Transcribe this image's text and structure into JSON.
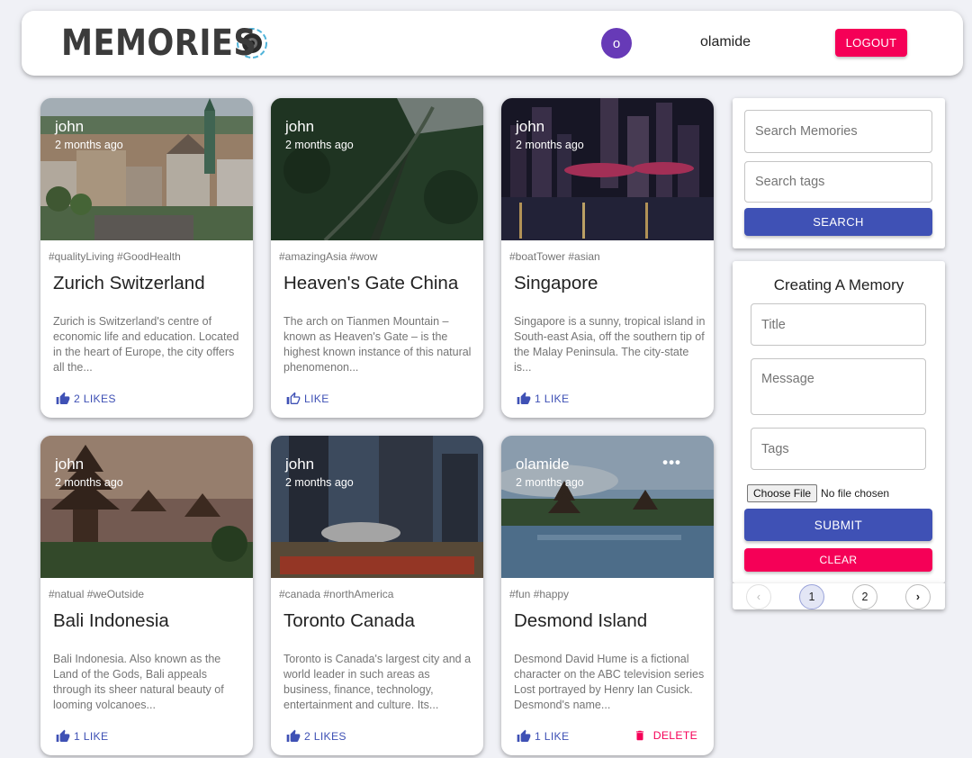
{
  "header": {
    "brand": "Memories",
    "avatar_initial": "o",
    "username": "olamide",
    "logout_label": "LOGOUT"
  },
  "posts": [
    {
      "author": "john",
      "time": "2 months ago",
      "tags": "#qualityLiving #GoodHealth",
      "title": "Zurich Switzerland",
      "message": "Zurich is Switzerland's centre of economic life and education. Located in the heart of Europe, the city offers all the...",
      "likes": "2 LIKES"
    },
    {
      "author": "john",
      "time": "2 months ago",
      "tags": "#amazingAsia #wow",
      "title": "Heaven's Gate China",
      "message": "The arch on Tianmen Mountain – known as Heaven's Gate – is the highest known instance of this natural phenomenon...",
      "likes": "LIKE"
    },
    {
      "author": "john",
      "time": "2 months ago",
      "tags": "#boatTower #asian",
      "title": "Singapore",
      "message": "Singapore is a sunny, tropical island in South-east Asia, off the southern tip of the Malay Peninsula. The city-state is...",
      "likes": "1 LIKE"
    },
    {
      "author": "john",
      "time": "2 months ago",
      "tags": "#natual #weOutside",
      "title": "Bali Indonesia",
      "message": "Bali Indonesia. Also known as the Land of the Gods, Bali appeals through its sheer natural beauty of looming volcanoes...",
      "likes": "1 LIKE"
    },
    {
      "author": "john",
      "time": "2 months ago",
      "tags": "#canada #northAmerica",
      "title": "Toronto Canada",
      "message": "Toronto is Canada's largest city and a world leader in such areas as business, finance, technology, entertainment and culture. Its...",
      "likes": "2 LIKES"
    },
    {
      "author": "olamide",
      "time": "2 months ago",
      "tags": "#fun #happy",
      "title": "Desmond Island",
      "message": "Desmond David Hume is a fictional character on the ABC television series Lost portrayed by Henry Ian Cusick. Desmond's name...",
      "likes": "1 LIKE",
      "more_glyph": "•••",
      "delete_label": "DELETE"
    }
  ],
  "search": {
    "memories_placeholder": "Search Memories",
    "tags_placeholder": "Search tags",
    "button_label": "SEARCH"
  },
  "form": {
    "title": "Creating A Memory",
    "title_placeholder": "Title",
    "message_placeholder": "Message",
    "tags_placeholder": "Tags",
    "file_button": "Choose File",
    "file_status": "No file chosen",
    "submit_label": "SUBMIT",
    "clear_label": "CLEAR"
  },
  "pagination": {
    "prev": "‹",
    "pages": [
      "1",
      "2"
    ],
    "current": "1",
    "next": "›"
  },
  "colors": {
    "primary": "#3f51b5",
    "secondary": "#f50057",
    "avatar": "#673ab7",
    "background": "#f0f1f6"
  }
}
